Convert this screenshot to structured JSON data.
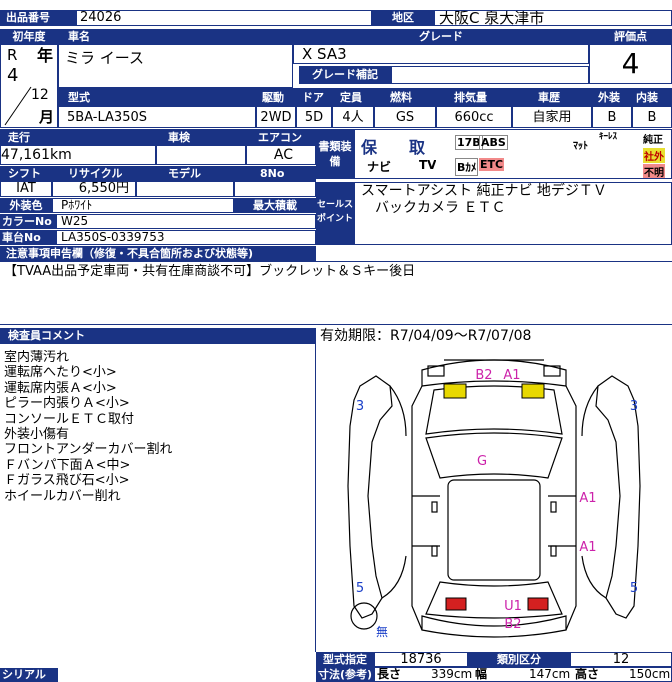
{
  "header": {
    "lot_label": "出品番号",
    "lot_no": "24026",
    "area_label": "地区",
    "area": "大阪C 泉大津市"
  },
  "car": {
    "year_label": "初年度",
    "name_label": "車名",
    "grade_label": "グレード",
    "score_label": "評価点",
    "era": "R",
    "year": "4",
    "year_unit": "年",
    "month": "12",
    "month_unit": "月",
    "name": "ミラ イース",
    "grade": "X SA3",
    "grade_supp_label": "グレード補記",
    "score": "4"
  },
  "spec_labels": {
    "model": "型式",
    "drive": "駆動",
    "door": "ドア",
    "capacity": "定員",
    "fuel": "燃料",
    "displacement": "排気量",
    "history": "車歴",
    "exterior": "外装",
    "interior": "内装"
  },
  "spec": {
    "model": "5BA-LA350S",
    "drive": "2WD",
    "door": "5D",
    "capacity": "4人",
    "fuel": "GS",
    "displacement": "660cc",
    "history": "自家用",
    "exterior": "B",
    "interior": "B"
  },
  "row2_labels": {
    "mileage": "走行",
    "inspection": "車検",
    "ac": "エアコン",
    "docs": "書類装備",
    "shift": "シフト",
    "recycle": "リサイクル",
    "model2": "モデル",
    "eight": "8No"
  },
  "row2": {
    "mileage": "47,161km",
    "inspection": "",
    "ac": "AC",
    "shift": "IAT",
    "recycle": "6,550円"
  },
  "equipment": {
    "ho": "保",
    "tori": "取",
    "b17": "17B",
    "abs": "ABS",
    "navi": "ナビ",
    "tv": "TV",
    "bkamera": "Bｶﾒ",
    "etc": "ETC",
    "mat": "ﾏｯﾄ",
    "keyless": "ｷｰﾚｽ",
    "genuine": "純正",
    "shagai": "社外",
    "fumei": "不明"
  },
  "color": {
    "label": "外装色",
    "value": "Pﾎﾜｲﾄ",
    "code_label": "カラーNo",
    "code": "W25",
    "max_load_label": "最大積載",
    "max_load": "",
    "chassis_label": "車台No",
    "chassis": "LA350S-0339753"
  },
  "sales": {
    "label": "セールスポイント",
    "line1": "スマートアシスト 純正ナビ 地デジＴＶ",
    "line2": "バックカメラ ＥＴＣ"
  },
  "notes": {
    "label": "注意事項申告欄（修復・不具合箇所および状態等)",
    "text": "【TVAA出品予定車両・共有在庫商談不可】ブックレット＆Ｓキー後日"
  },
  "inspector": {
    "label": "検査員コメント",
    "comments": [
      "室内薄汚れ",
      "運転席へたり<小>",
      "運転席内張Ａ<小>",
      "ピラー内張りＡ<小>",
      "コンソールＥＴＣ取付",
      "外装小傷有",
      "フロントアンダーカバー割れ",
      "Ｆバンパ下面Ａ<中>",
      "Ｆガラス飛び石<小>",
      "ホイールカバー削れ"
    ]
  },
  "validity": "有効期限：R7/04/09～R7/07/08",
  "diagram": {
    "marks": [
      "B2",
      "A1",
      "3",
      "3",
      "G",
      "A1",
      "A1",
      "5",
      "5",
      "U1",
      "B2",
      "無"
    ],
    "colors": {
      "pink": "#cc22aa",
      "blue": "#1a3fc8",
      "yellow": "#e8d800",
      "red": "#d42020"
    }
  },
  "footer": {
    "serial_label": "シリアルNo",
    "type_label": "型式指定",
    "type_value": "18736",
    "class_label": "類別区分",
    "class_value": "12",
    "size_label": "寸法(参考)",
    "length_label": "長さ",
    "length": "339cm",
    "width_label": "幅",
    "width": "147cm",
    "height_label": "高さ",
    "height": "150cm"
  }
}
